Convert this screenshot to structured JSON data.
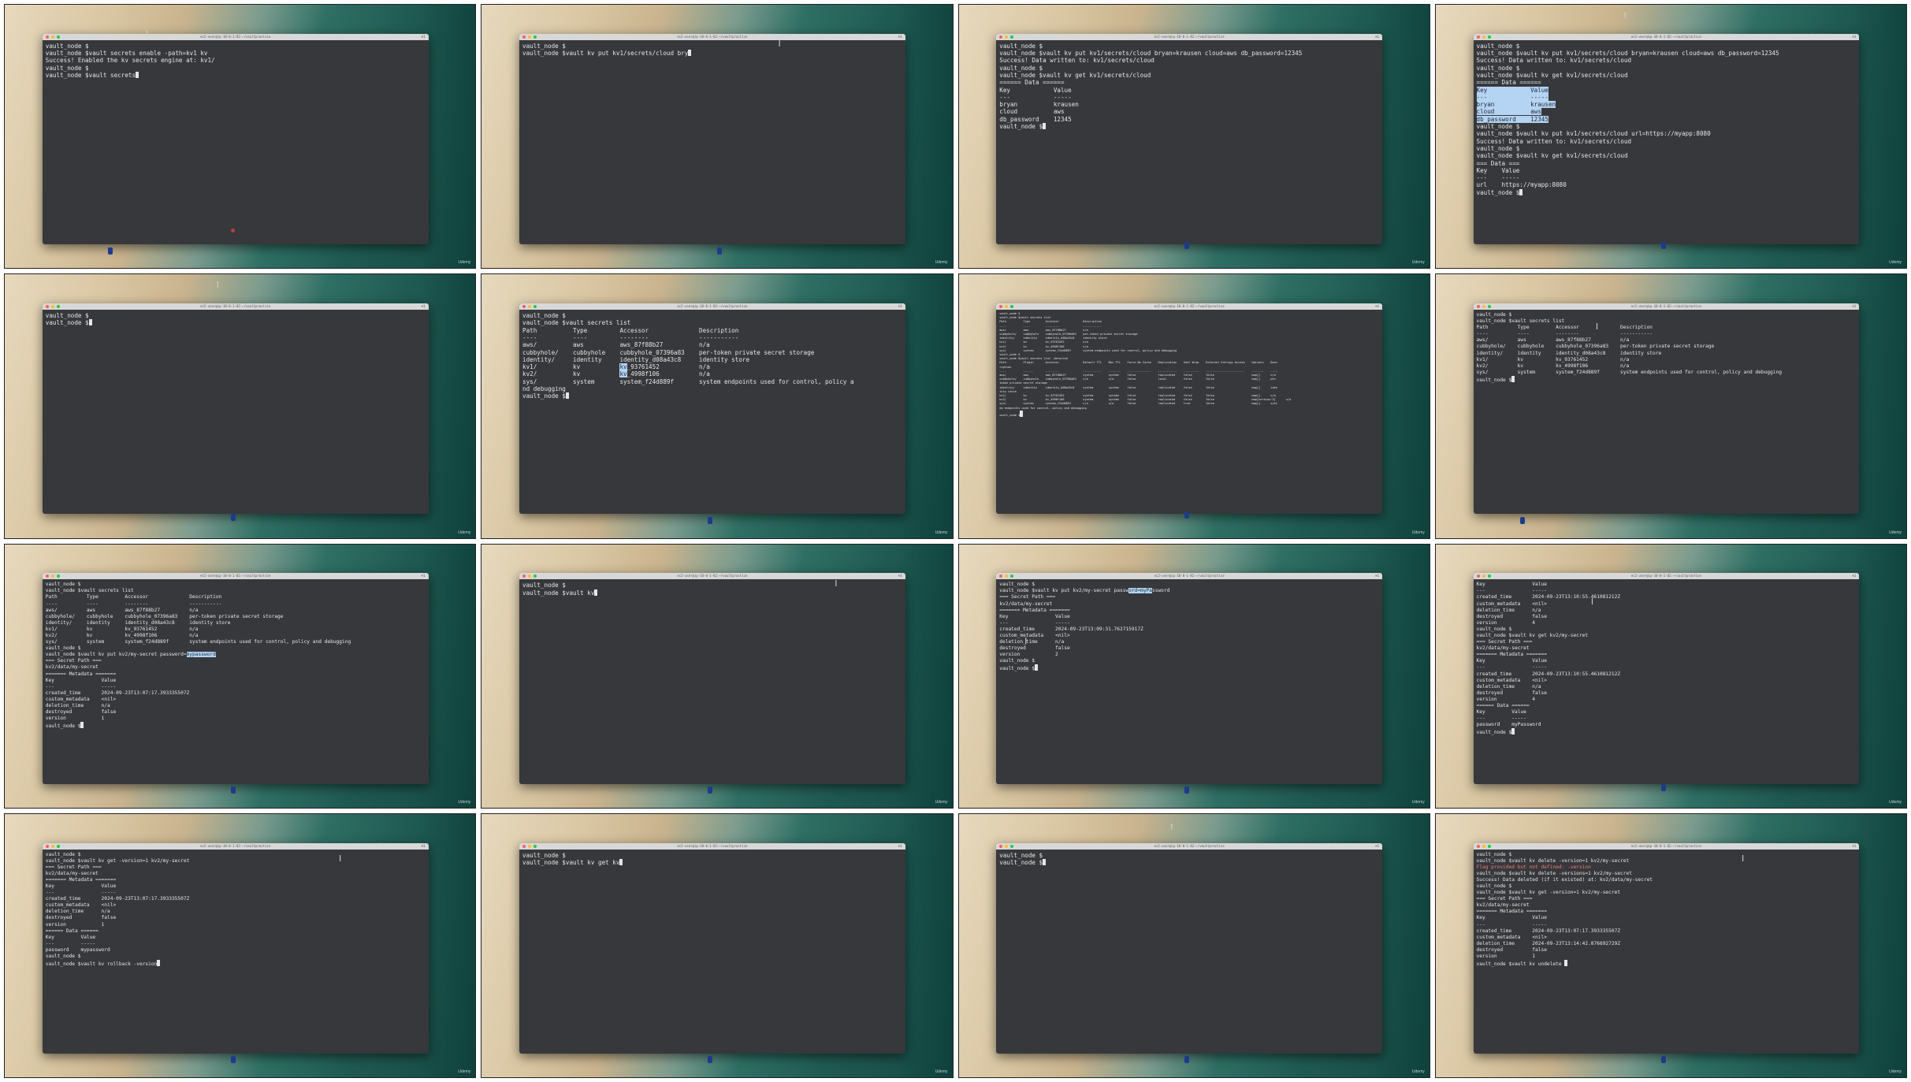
{
  "watermark": "Udemy",
  "frames": [
    {
      "title": "ec2-user@ip-10-0-1-82:~/vaultpractice",
      "tab": "⌘1",
      "cursor": true,
      "lines": [
        "vault_node $",
        "vault_node $vault secrets enable -path=kv1 kv",
        "Success! Enabled the kv secrets engine at: kv1/",
        "vault_node $",
        "vault_node $vault secrets"
      ]
    },
    {
      "title": "ec2-user@ip-10-0-1-82:~/vaultpractice",
      "tab": "⌘1",
      "cursor": true,
      "lines": [
        "vault_node $",
        "vault_node $vault kv put kv1/secrets/cloud bry"
      ]
    },
    {
      "title": "ec2-user@ip-10-0-1-82:~/vaultpractice",
      "tab": "⌘1",
      "cursor": true,
      "lines": [
        "vault_node $",
        "vault_node $vault kv put kv1/secrets/cloud bryan=krausen cloud=aws db_password=12345",
        "Success! Data written to: kv1/secrets/cloud",
        "vault_node $",
        "vault_node $vault kv get kv1/secrets/cloud",
        "====== Data ======",
        "Key            Value",
        "---            -----",
        "bryan          krausen",
        "cloud          aws",
        "db_password    12345",
        "vault_node $"
      ]
    },
    {
      "title": "ec2-user@ip-10-0-1-82:~/vaultpractice",
      "tab": "⌘1",
      "cursor": true,
      "lines": [
        "vault_node $",
        "vault_node $vault kv put kv1/secrets/cloud bryan=krausen cloud=aws db_password=12345",
        "Success! Data written to: kv1/secrets/cloud",
        "vault_node $",
        "vault_node $vault kv get kv1/secrets/cloud",
        "====== Data ======",
        "Key            Value",
        "---            -----",
        "bryan          krausen",
        "cloud          aws",
        "db_password    12345",
        "vault_node $",
        "vault_node $vault kv put kv1/secrets/cloud url=https://myapp:8080",
        "Success! Data written to: kv1/secrets/cloud",
        "vault_node $",
        "vault_node $vault kv get kv1/secrets/cloud",
        "=== Data ===",
        "Key    Value",
        "---    -----",
        "url    https://myapp:8080",
        "vault_node $"
      ]
    },
    {
      "title": "ec2-user@ip-10-0-1-82:~/vaultpractice",
      "tab": "⌘1",
      "cursor": true,
      "lines": [
        "vault_node $",
        "vault_node $"
      ]
    },
    {
      "title": "ec2-user@ip-10-0-1-82:~/vaultpractice",
      "tab": "⌘1",
      "cursor": true,
      "lines": [
        "vault_node $",
        "vault_node $vault secrets list",
        "Path          Type         Accessor              Description",
        "----          ----         --------              -----------",
        "aws/          aws          aws_87f88b27          n/a",
        "cubbyhole/    cubbyhole    cubbyhole_07396a83    per-token private secret storage",
        "identity/     identity     identity_d08a43c8     identity store",
        "kv1/          kv           kv_93761452           n/a",
        "kv2/          kv           kv_4998f106           n/a",
        "sys/          system       system_f24d889f       system endpoints used for control, policy a",
        "nd debugging",
        "vault_node $"
      ]
    },
    {
      "title": "ec2-user@ip-10-0-1-82:~/vaultpractice",
      "tab": "⌘1",
      "cursor": true,
      "lines": [
        "vault_node $",
        "vault_node $vault secrets list",
        "Path          Type         Accessor              Description",
        "----          ----         --------              -----------",
        "aws/          aws          aws_87f88b27          n/a",
        "cubbyhole/    cubbyhole    cubbyhole_07396a83    per-token private secret storage",
        "identity/     identity     identity_d08a43c8     identity store",
        "kv1/          kv           kv_93761452           n/a",
        "kv2/          kv           kv_4998f106           n/a",
        "sys/          system       system_f24d889f       system endpoints used for control, policy and debugging",
        "vault_node $",
        "vault_node $vault secrets list -detailed",
        "Path          Plugin       Accessor              Default TTL    Max TTL    Force No Cache    Replication    Seal Wrap    External Entropy Access    Options    Desc",
        "ription",
        "----          ------       --------              -----------    -------    --------------    -----------    ---------    -----------------------    -------    ----",
        "aws/          aws          aws_87f88b27          system         system     false             replicated     false        false                      map[]      n/a",
        "cubbyhole/    cubbyhole    cubbyhole_07396a83    n/a            n/a        false             local          false        false                      map[]      per-",
        "token private secret storage",
        "identity/     identity     identity_d08a43c8     system         system     false             replicated     false        false                      map[]      iden",
        "tity store",
        "kv1/          kv           kv_93761452           system         system     false             replicated     false        false                      map[]      n/a",
        "kv2/          kv           kv_4998f106           system         system     false             replicated     false        false                      map[version:2]      n/a",
        "sys/          system       system_f24d889f       n/a            n/a        false             replicated     true         false                      map[]      syst",
        "em endpoints used for control, policy and debugging",
        "vault_node $"
      ]
    },
    {
      "title": "ec2-user@ip-10-0-1-82:~/vaultpractice",
      "tab": "⌘1",
      "cursor": true,
      "lines": [
        "vault_node $",
        "vault_node $vault secrets list",
        "Path          Type         Accessor              Description",
        "----          ----         --------              -----------",
        "aws/          aws          aws_87f88b27          n/a",
        "cubbyhole/    cubbyhole    cubbyhole_07396a83    per-token private secret storage",
        "identity/     identity     identity_d08a43c8     identity store",
        "kv1/          kv           kv_93761452           n/a",
        "kv2/          kv           kv_4998f106           n/a",
        "sys/          system       system_f24d889f       system endpoints used for control, policy and debugging",
        "vault_node $"
      ]
    },
    {
      "title": "ec2-user@ip-10-0-1-82:~/vaultpractice",
      "tab": "⌘1",
      "cursor": true,
      "lines": [
        "vault_node $",
        "vault_node $vault secrets list",
        "Path          Type         Accessor              Description",
        "----          ----         --------              -----------",
        "aws/          aws          aws_87f88b27          n/a",
        "cubbyhole/    cubbyhole    cubbyhole_07396a83    per-token private secret storage",
        "identity/     identity     identity_d08a43c8     identity store",
        "kv1/          kv           kv_93761452           n/a",
        "kv2/          kv           kv_4998f106           n/a",
        "sys/          system       system_f24d889f       system endpoints used for control, policy and debugging",
        "vault_node $",
        "vault_node $vault kv put kv2/my-secret password=mypassword",
        "=== Secret Path ===",
        "kv2/data/my-secret",
        "",
        "======= Metadata =======",
        "Key                Value",
        "---                -----",
        "created_time       2024-09-23T13:07:17.393335507Z",
        "custom_metadata    <nil>",
        "deletion_time      n/a",
        "destroyed          false",
        "version            1",
        "vault_node $"
      ]
    },
    {
      "title": "ec2-user@ip-10-0-1-82:~/vaultpractice",
      "tab": "⌘1",
      "cursor": true,
      "lines": [
        "vault_node $",
        "vault_node $vault kv"
      ]
    },
    {
      "title": "ec2-user@ip-10-0-1-82:~/vaultpractice",
      "tab": "⌘1",
      "cursor": true,
      "lines": [
        "vault_node $",
        "vault_node $vault kv put kv2/my-secret password=myPassword",
        "=== Secret Path ===",
        "kv2/data/my-secret",
        "",
        "======= Metadata =======",
        "Key                Value",
        "---                -----",
        "created_time       2024-09-23T13:09:31.762715917Z",
        "custom_metadata    <nil>",
        "deletion_time      n/a",
        "destroyed          false",
        "version            2",
        "vault_node $",
        "vault_node $"
      ]
    },
    {
      "title": "ec2-user@ip-10-0-1-82:~/vaultpractice",
      "tab": "⌘1",
      "cursor": true,
      "lines": [
        "Key                Value",
        "---                -----",
        "created_time       2024-09-23T13:10:55.461081212Z",
        "custom_metadata    <nil>",
        "deletion_time      n/a",
        "destroyed          false",
        "version            4",
        "vault_node $",
        "vault_node $vault kv get kv2/my-secret",
        "=== Secret Path ===",
        "kv2/data/my-secret",
        "",
        "======= Metadata =======",
        "Key                Value",
        "---                -----",
        "created_time       2024-09-23T13:10:55.461081212Z",
        "custom_metadata    <nil>",
        "deletion_time      n/a",
        "destroyed          false",
        "version            4",
        "",
        "====== Data ======",
        "Key         Value",
        "---         -----",
        "password    myPassword",
        "vault_node $"
      ]
    },
    {
      "title": "ec2-user@ip-10-0-1-82:~/vaultpractice",
      "tab": "⌘1",
      "cursor": true,
      "lines": [
        "vault_node $",
        "vault_node $vault kv get -version=1 kv2/my-secret",
        "=== Secret Path ===",
        "kv2/data/my-secret",
        "",
        "======= Metadata =======",
        "Key                Value",
        "---                -----",
        "created_time       2024-09-23T13:07:17.393335507Z",
        "custom_metadata    <nil>",
        "deletion_time      n/a",
        "destroyed          false",
        "version            1",
        "",
        "====== Data ======",
        "Key         Value",
        "---         -----",
        "password    mypassword",
        "vault_node $",
        "vault_node $vault kv rollback -version"
      ]
    },
    {
      "title": "ec2-user@ip-10-0-1-82:~/vaultpractice",
      "tab": "⌘1",
      "cursor": true,
      "lines": [
        "vault_node $",
        "vault_node $vault kv get kv"
      ]
    },
    {
      "title": "ec2-user@ip-10-0-1-82:~/vaultpractice",
      "tab": "⌘1",
      "cursor": true,
      "lines": [
        "vault_node $",
        "vault_node $"
      ]
    },
    {
      "title": "ec2-user@ip-10-0-1-82:~/vaultpractice",
      "tab": "⌘1",
      "cursor": true,
      "lines": [
        "vault_node $",
        "vault_node $vault kv delete -version=1 kv2/my-secret",
        "Flag provided but not defined: -version",
        "vault_node $vault kv delete -versions=1 kv2/my-secret",
        "Success! Data deleted (if it existed) at: kv2/data/my-secret",
        "vault_node $",
        "vault_node $vault kv get -version=1 kv2/my-secret",
        "=== Secret Path ===",
        "kv2/data/my-secret",
        "",
        "======= Metadata =======",
        "Key                Value",
        "---                -----",
        "created_time       2024-09-23T13:07:17.393335507Z",
        "custom_metadata    <nil>",
        "deletion_time      2024-09-23T13:14:42.876692729Z",
        "destroyed          false",
        "version            1",
        "",
        "vault_node $vault kv undelete "
      ]
    }
  ]
}
